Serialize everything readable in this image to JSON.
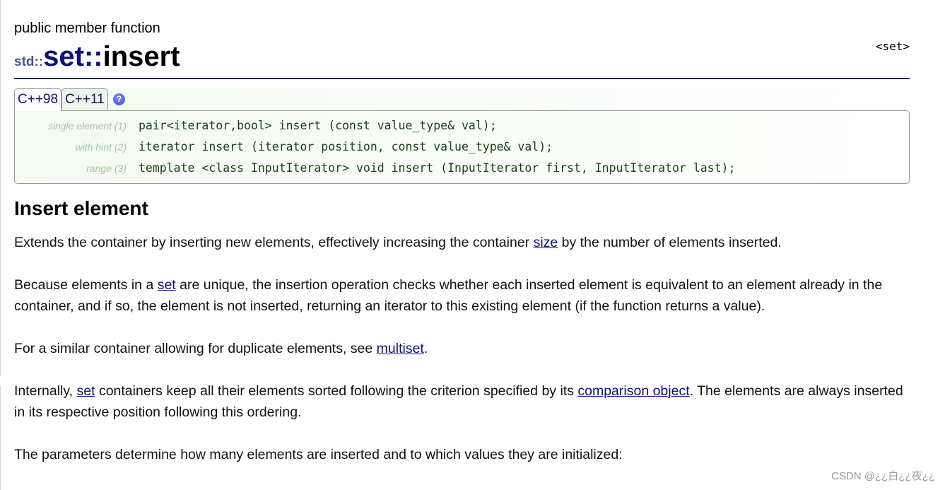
{
  "header": {
    "kind": "public member function",
    "title_ns": "std::",
    "title_class": "set",
    "title_sep": "::",
    "title_fn": "insert",
    "header_tag": "<set>"
  },
  "tabs": [
    {
      "label": "C++98",
      "active": true
    },
    {
      "label": "C++11",
      "active": false
    }
  ],
  "help_icon": {
    "name": "help-icon",
    "glyph": "?"
  },
  "prototypes": [
    {
      "label": "single element (1)",
      "code": "pair<iterator,bool> insert (const value_type& val);"
    },
    {
      "label": "with hint (2)",
      "code": "iterator insert (iterator position, const value_type& val);"
    },
    {
      "label": "range (3)",
      "code": "template <class InputIterator>  void insert (InputIterator first, InputIterator last);"
    }
  ],
  "section_title": "Insert element",
  "paragraphs": {
    "p1": {
      "a": "Extends the container by inserting new elements, effectively increasing the container ",
      "link": "size",
      "b": " by the number of elements inserted."
    },
    "p2": {
      "a": "Because elements in a ",
      "link": "set",
      "b": " are unique, the insertion operation checks whether each inserted element is equivalent to an element already in the container, and if so, the element is not inserted, returning an iterator to this existing element (if the function returns a value)."
    },
    "p3": {
      "a": "For a similar container allowing for duplicate elements, see ",
      "link": "multiset",
      "b": "."
    },
    "p4": {
      "a": "Internally, ",
      "link1": "set",
      "b": " containers keep all their elements sorted following the criterion specified by its ",
      "link2": "comparison object",
      "c": ". The elements are always inserted in its respective position following this ordering."
    },
    "p5": {
      "text": "The parameters determine how many elements are inserted and to which values they are initialized:"
    }
  },
  "watermark": "CSDN @¿¿白¿¿夜¿¿",
  "colors": {
    "link": "#0f0f7a",
    "ns": "#4b4f96",
    "rule": "#1e2a50",
    "code": "#1a3f1a",
    "proto_label": "#a6c5a0"
  }
}
